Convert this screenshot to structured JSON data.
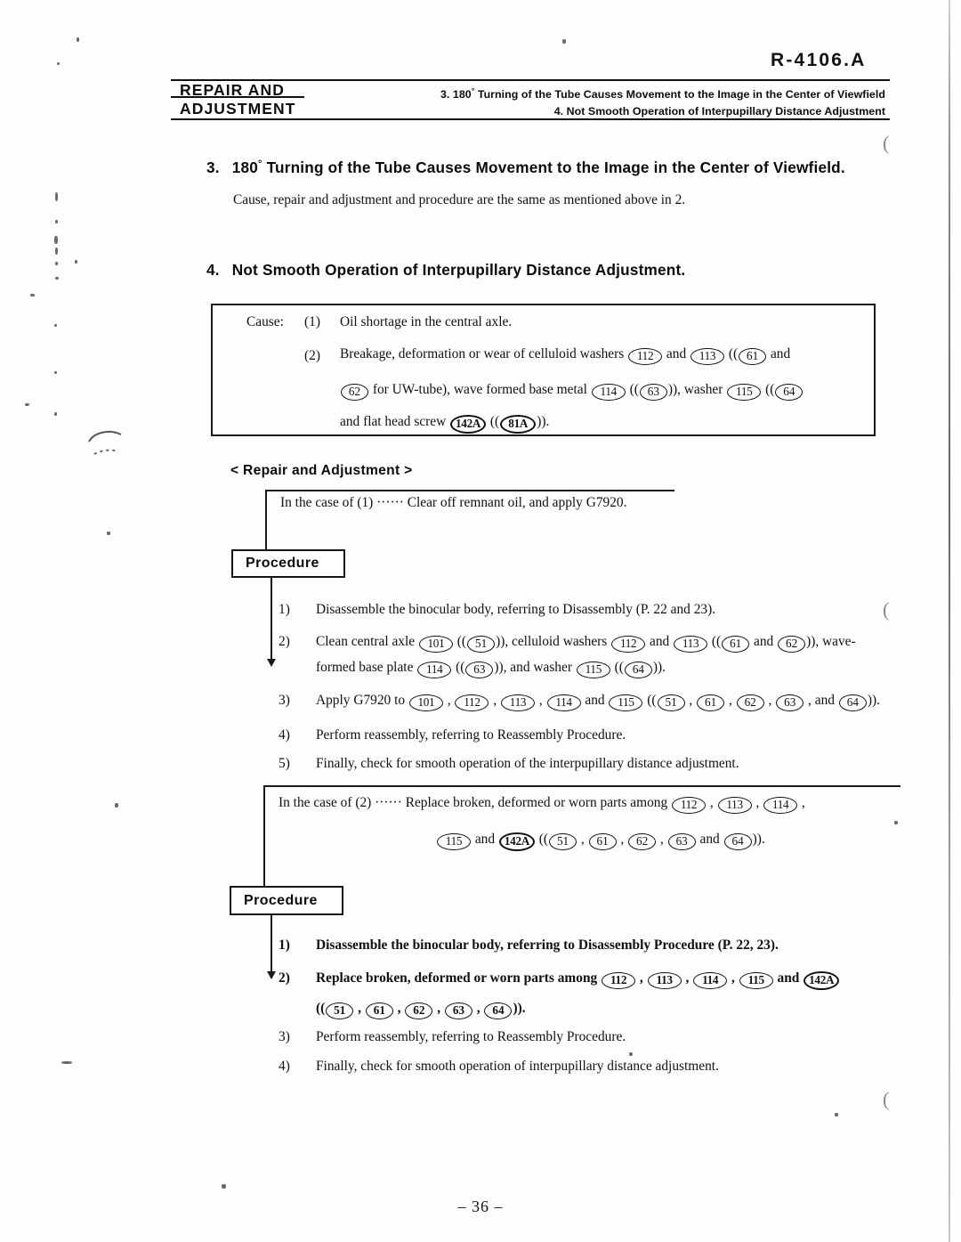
{
  "document": {
    "code": "R-4106.A",
    "page_number": "– 36 –"
  },
  "header": {
    "left_line1": "REPAIR  AND",
    "left_line2": "ADJUSTMENT",
    "right_line1_prefix": "3. 180",
    "right_line1_deg": "°",
    "right_line1_rest": " Turning of the Tube Causes Movement to the Image in the Center of Viewfield",
    "right_line2": "4. Not Smooth Operation of Interpupillary Distance Adjustment"
  },
  "section3": {
    "number": "3.",
    "title_prefix": "180",
    "title_deg": "°",
    "title_rest": " Turning of the Tube Causes Movement to the Image in the Center of Viewfield.",
    "body": "Cause, repair and adjustment and procedure are the same as mentioned above in 2."
  },
  "section4": {
    "number": "4.",
    "title": "Not Smooth Operation of Interpupillary Distance Adjustment."
  },
  "cause_box": {
    "label": "Cause:",
    "items": [
      {
        "index": "(1)",
        "lines": [
          {
            "segments": [
              {
                "t": "text",
                "v": "Oil shortage in the central axle."
              }
            ]
          }
        ]
      },
      {
        "index": "(2)",
        "lines": [
          {
            "segments": [
              {
                "t": "text",
                "v": "Breakage, deformation or wear of celluloid washers "
              },
              {
                "t": "pn",
                "v": "112"
              },
              {
                "t": "text",
                "v": " and "
              },
              {
                "t": "pn",
                "v": "113"
              },
              {
                "t": "text",
                "v": " (("
              },
              {
                "t": "pn",
                "v": "61"
              },
              {
                "t": "text",
                "v": " and"
              }
            ]
          },
          {
            "segments": [
              {
                "t": "pn",
                "v": "62"
              },
              {
                "t": "text",
                "v": " for UW-tube), wave formed base metal "
              },
              {
                "t": "pn",
                "v": "114"
              },
              {
                "t": "text",
                "v": " (("
              },
              {
                "t": "pn",
                "v": "63"
              },
              {
                "t": "text",
                "v": ")), washer "
              },
              {
                "t": "pn",
                "v": "115"
              },
              {
                "t": "text",
                "v": " (("
              },
              {
                "t": "pn",
                "v": "64"
              }
            ]
          },
          {
            "segments": [
              {
                "t": "text",
                "v": "and flat head screw "
              },
              {
                "t": "pn_bold",
                "v": "142A"
              },
              {
                "t": "text",
                "v": " (("
              },
              {
                "t": "pn_bold",
                "v": "81A"
              },
              {
                "t": "text",
                "v": "))."
              }
            ]
          }
        ]
      }
    ]
  },
  "repair_label": "< Repair and Adjustment >",
  "case1": {
    "text_lines": [
      {
        "segments": [
          {
            "t": "text",
            "v": "In the case of (1)  ······ Clear off remnant oil, and apply G7920."
          }
        ]
      }
    ],
    "procedure_label": "Procedure",
    "steps": [
      {
        "marker": "1)",
        "lines": [
          {
            "segments": [
              {
                "t": "text",
                "v": "Disassemble the binocular body, referring to Disassembly (P. 22 and 23)."
              }
            ]
          }
        ]
      },
      {
        "marker": "2)",
        "lines": [
          {
            "segments": [
              {
                "t": "text",
                "v": "Clean central axle "
              },
              {
                "t": "pn",
                "v": "101"
              },
              {
                "t": "text",
                "v": " (("
              },
              {
                "t": "pn",
                "v": "51"
              },
              {
                "t": "text",
                "v": ")), celluloid washers "
              },
              {
                "t": "pn",
                "v": "112"
              },
              {
                "t": "text",
                "v": " and "
              },
              {
                "t": "pn",
                "v": "113"
              },
              {
                "t": "text",
                "v": " (("
              },
              {
                "t": "pn",
                "v": "61"
              },
              {
                "t": "text",
                "v": " and "
              },
              {
                "t": "pn",
                "v": "62"
              },
              {
                "t": "text",
                "v": ")), wave-"
              }
            ]
          },
          {
            "segments": [
              {
                "t": "text",
                "v": "formed base plate "
              },
              {
                "t": "pn",
                "v": "114"
              },
              {
                "t": "text",
                "v": " (("
              },
              {
                "t": "pn",
                "v": "63"
              },
              {
                "t": "text",
                "v": ")), and washer "
              },
              {
                "t": "pn",
                "v": "115"
              },
              {
                "t": "text",
                "v": " (("
              },
              {
                "t": "pn",
                "v": "64"
              },
              {
                "t": "text",
                "v": "))."
              }
            ]
          }
        ]
      },
      {
        "marker": "3)",
        "lines": [
          {
            "segments": [
              {
                "t": "text",
                "v": "Apply G7920 to "
              },
              {
                "t": "pn",
                "v": "101"
              },
              {
                "t": "text",
                "v": " , "
              },
              {
                "t": "pn",
                "v": "112"
              },
              {
                "t": "text",
                "v": " , "
              },
              {
                "t": "pn",
                "v": "113"
              },
              {
                "t": "text",
                "v": " , "
              },
              {
                "t": "pn",
                "v": "114"
              },
              {
                "t": "text",
                "v": " and "
              },
              {
                "t": "pn",
                "v": "115"
              },
              {
                "t": "text",
                "v": " (("
              },
              {
                "t": "pn",
                "v": "51"
              },
              {
                "t": "text",
                "v": " , "
              },
              {
                "t": "pn",
                "v": "61"
              },
              {
                "t": "text",
                "v": " , "
              },
              {
                "t": "pn",
                "v": "62"
              },
              {
                "t": "text",
                "v": " , "
              },
              {
                "t": "pn",
                "v": "63"
              },
              {
                "t": "text",
                "v": " , and "
              },
              {
                "t": "pn",
                "v": "64"
              },
              {
                "t": "text",
                "v": "))."
              }
            ]
          }
        ]
      },
      {
        "marker": "4)",
        "lines": [
          {
            "segments": [
              {
                "t": "text",
                "v": "Perform reassembly, referring to Reassembly Procedure."
              }
            ]
          }
        ]
      },
      {
        "marker": "5)",
        "lines": [
          {
            "segments": [
              {
                "t": "text",
                "v": "Finally, check for smooth operation of the interpupillary distance adjustment."
              }
            ]
          }
        ]
      }
    ]
  },
  "case2": {
    "text_lines": [
      {
        "segments": [
          {
            "t": "text",
            "v": "In the case of (2)  ······  Replace broken, deformed or worn parts among "
          },
          {
            "t": "pn",
            "v": "112"
          },
          {
            "t": "text",
            "v": " , "
          },
          {
            "t": "pn",
            "v": "113"
          },
          {
            "t": "text",
            "v": " , "
          },
          {
            "t": "pn",
            "v": "114"
          },
          {
            "t": "text",
            "v": " ,"
          }
        ]
      },
      {
        "segments": [
          {
            "t": "pn",
            "v": "115"
          },
          {
            "t": "text",
            "v": " and "
          },
          {
            "t": "pn_bold",
            "v": "142A"
          },
          {
            "t": "text",
            "v": " (("
          },
          {
            "t": "pn",
            "v": "51"
          },
          {
            "t": "text",
            "v": " , "
          },
          {
            "t": "pn",
            "v": "61"
          },
          {
            "t": "text",
            "v": " , "
          },
          {
            "t": "pn",
            "v": "62"
          },
          {
            "t": "text",
            "v": " , "
          },
          {
            "t": "pn",
            "v": "63"
          },
          {
            "t": "text",
            "v": " and "
          },
          {
            "t": "pn",
            "v": "64"
          },
          {
            "t": "text",
            "v": "))."
          }
        ]
      }
    ],
    "procedure_label": "Procedure",
    "steps": [
      {
        "marker": "1)",
        "bold": true,
        "lines": [
          {
            "segments": [
              {
                "t": "text",
                "v": "Disassemble the binocular body, referring to Disassembly  Procedure (P. 22, 23)."
              }
            ]
          }
        ]
      },
      {
        "marker": "2)",
        "bold": true,
        "lines": [
          {
            "segments": [
              {
                "t": "text",
                "v": "Replace broken, deformed or worn parts among "
              },
              {
                "t": "pn",
                "v": "112"
              },
              {
                "t": "text",
                "v": " , "
              },
              {
                "t": "pn",
                "v": "113"
              },
              {
                "t": "text",
                "v": " , "
              },
              {
                "t": "pn",
                "v": "114"
              },
              {
                "t": "text",
                "v": " , "
              },
              {
                "t": "pn",
                "v": "115"
              },
              {
                "t": "text",
                "v": " and  "
              },
              {
                "t": "pn_bold",
                "v": "142A"
              }
            ]
          },
          {
            "segments": [
              {
                "t": "text",
                "v": "(("
              },
              {
                "t": "pn",
                "v": "51"
              },
              {
                "t": "text",
                "v": " , "
              },
              {
                "t": "pn",
                "v": "61"
              },
              {
                "t": "text",
                "v": " , "
              },
              {
                "t": "pn",
                "v": "62"
              },
              {
                "t": "text",
                "v": " , "
              },
              {
                "t": "pn",
                "v": "63"
              },
              {
                "t": "text",
                "v": " , "
              },
              {
                "t": "pn",
                "v": "64"
              },
              {
                "t": "text",
                "v": "))."
              }
            ]
          }
        ]
      },
      {
        "marker": "3)",
        "lines": [
          {
            "segments": [
              {
                "t": "text",
                "v": "Perform reassembly, referring to Reassembly Procedure."
              }
            ]
          }
        ]
      },
      {
        "marker": "4)",
        "lines": [
          {
            "segments": [
              {
                "t": "text",
                "v": "Finally, check for smooth operation of interpupillary distance adjustment."
              }
            ]
          }
        ]
      }
    ]
  }
}
